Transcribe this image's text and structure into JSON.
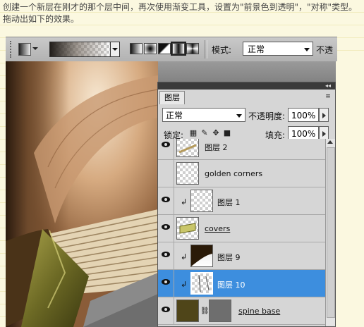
{
  "caption": "创建一个新层在刚才的那个层中间，再次使用渐变工具，设置为\"前景色到透明\"，\"对称\"类型。拖动出如下的效果。",
  "toolbar": {
    "mode_label": "模式:",
    "mode_value": "正常",
    "opacity_label_cut": "不透"
  },
  "panel": {
    "tab": "图层",
    "blend_mode": "正常",
    "opacity_label": "不透明度:",
    "opacity_value": "100%",
    "lock_label": "锁定:",
    "fill_label": "填充:",
    "fill_value": "100%"
  },
  "layers": [
    {
      "name": "图层 2",
      "visible": true,
      "clipped": false,
      "selected": false
    },
    {
      "name": "golden corners",
      "visible": false,
      "clipped": false,
      "selected": false
    },
    {
      "name": "图层 1",
      "visible": true,
      "clipped": true,
      "selected": false
    },
    {
      "name": "covers",
      "visible": true,
      "clipped": false,
      "selected": false,
      "underlined": true
    },
    {
      "name": "图层 9",
      "visible": true,
      "clipped": true,
      "selected": false
    },
    {
      "name": "图层 10",
      "visible": true,
      "clipped": true,
      "selected": true
    },
    {
      "name": "spine base",
      "visible": true,
      "clipped": false,
      "selected": false,
      "underlined": true
    }
  ],
  "colors": {
    "selected_row": "#3d8ede",
    "page_background": "#fbf8e0"
  }
}
